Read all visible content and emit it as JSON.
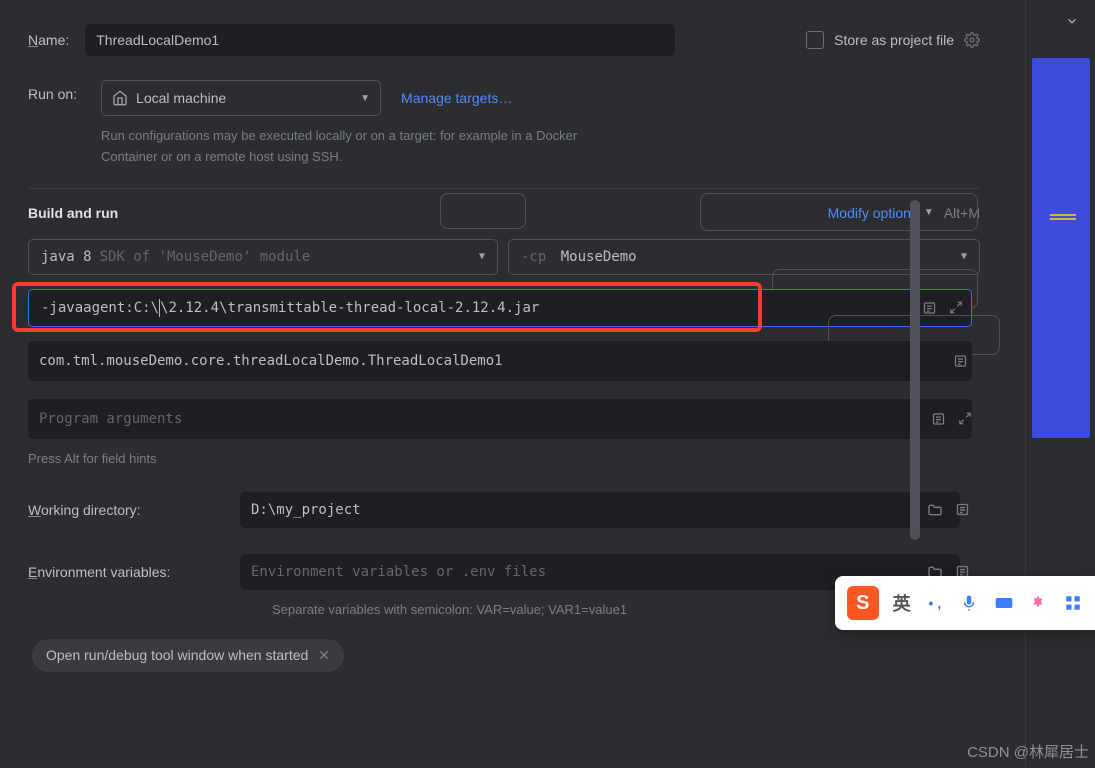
{
  "labels": {
    "name": "Name:",
    "run_on": "Run on:",
    "manage_targets": "Manage targets…",
    "run_on_hint": "Run configurations may be executed locally or on a target: for example in a Docker Container or on a remote host using SSH.",
    "build_and_run": "Build and run",
    "modify_options": "Modify options",
    "modify_shortcut": "Alt+M",
    "store_project": "Store as project file",
    "sdk_hint": "SDK of 'MouseDemo' module",
    "cp_prefix": "-cp",
    "program_args_ph": "Program arguments",
    "field_hints": "Press Alt for field hints",
    "working_dir": "Working directory:",
    "env_vars": "Environment variables:",
    "env_vars_ph": "Environment variables or .env files",
    "env_hint": "Separate variables with semicolon: VAR=value; VAR1=value1",
    "open_tool_chip": "Open run/debug tool window when started"
  },
  "values": {
    "name": "ThreadLocalDemo1",
    "run_on_target": "Local machine",
    "sdk": "java 8",
    "module": "MouseDemo",
    "vm_options_pre": "-javaagent:C:\\",
    "vm_options_post": "\\2.12.4\\transmittable-thread-local-2.12.4.jar",
    "main_class": "com.tml.mouseDemo.core.threadLocalDemo.ThreadLocalDemo1",
    "working_dir": "D:\\my_project"
  },
  "ime": {
    "lang": "英"
  },
  "watermark": "CSDN @林犀居士"
}
